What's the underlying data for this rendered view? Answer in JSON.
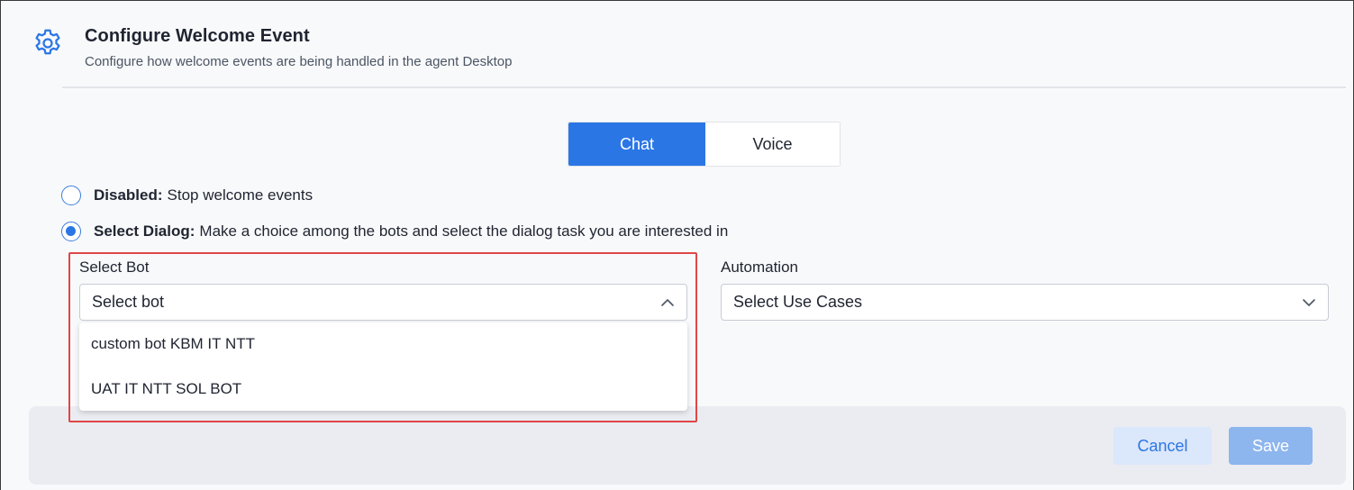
{
  "header": {
    "icon": "gear-icon",
    "title": "Configure Welcome Event",
    "subtitle": "Configure how welcome events are being handled in the agent Desktop"
  },
  "channel_toggle": {
    "options": [
      "Chat",
      "Voice"
    ],
    "selected": "Chat",
    "accent_color": "#2b76e5"
  },
  "radios": [
    {
      "label_bold": "Disabled:",
      "label_text": "Stop welcome events",
      "checked": false
    },
    {
      "label_bold": "Select Dialog:",
      "label_text": "Make a choice among the bots and select the dialog task you are interested in",
      "checked": true
    }
  ],
  "select_bot": {
    "label": "Select Bot",
    "value": "Select bot",
    "expanded": true,
    "options": [
      "custom bot KBM IT NTT",
      "UAT IT NTT SOL BOT"
    ]
  },
  "automation": {
    "label": "Automation",
    "value": "Select Use Cases",
    "expanded": false
  },
  "footer": {
    "cancel_label": "Cancel",
    "save_label": "Save"
  },
  "annotation": {
    "highlight_color": "#e04646"
  }
}
